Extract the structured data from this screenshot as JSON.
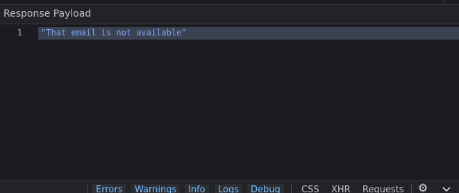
{
  "section": {
    "title": "Response Payload"
  },
  "editor": {
    "lines": [
      {
        "number": "1",
        "text": "\"That email is not available\""
      }
    ]
  },
  "toolbar": {
    "filters": [
      {
        "label": "Errors",
        "active": true
      },
      {
        "label": "Warnings",
        "active": true
      },
      {
        "label": "Info",
        "active": true
      },
      {
        "label": "Logs",
        "active": true
      },
      {
        "label": "Debug",
        "active": true
      },
      {
        "label": "CSS",
        "active": false
      },
      {
        "label": "XHR",
        "active": false
      },
      {
        "label": "Requests",
        "active": false
      }
    ],
    "icons": [
      "gear-icon",
      "chevron-down-icon"
    ]
  },
  "colors": {
    "background": "#1c1b22",
    "header": "#232327",
    "string": "#86a6f4",
    "active_filter": "#75bfff",
    "line_highlight": "#3b4252"
  }
}
